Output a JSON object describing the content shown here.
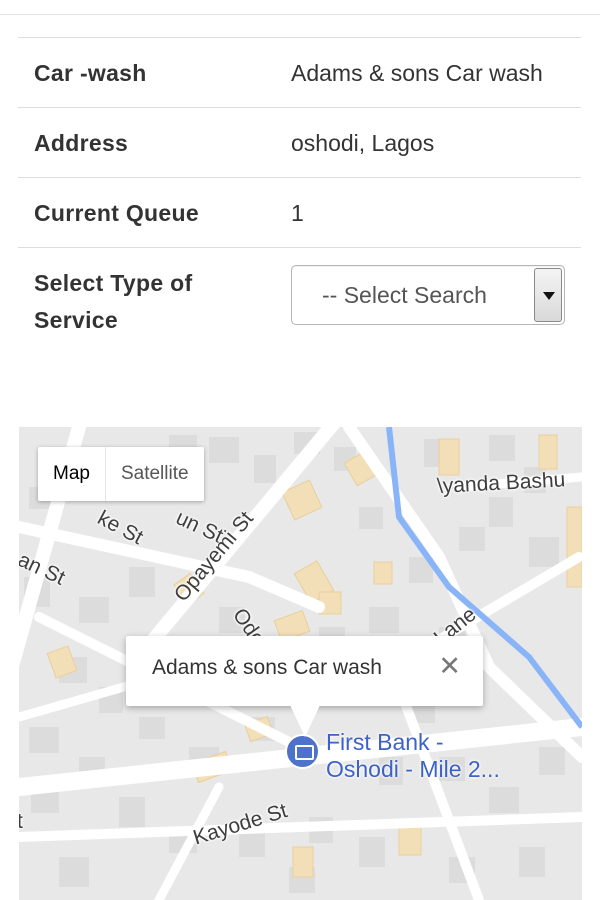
{
  "details": {
    "rows": [
      {
        "label": "Car -wash",
        "value": "Adams & sons Car wash"
      },
      {
        "label": "Address",
        "value": "oshodi, Lagos"
      },
      {
        "label": "Current Queue",
        "value": "1"
      }
    ],
    "service_label": "Select Type of Service",
    "service_select": {
      "selected": "-- Select Search"
    }
  },
  "map": {
    "type_controls": {
      "map": "Map",
      "satellite": "Satellite"
    },
    "infowindow": {
      "title": "Adams & sons Car wash",
      "close": "✕"
    },
    "poi": {
      "line1": "First Bank -",
      "line2": "Oshodi - Mile 2..."
    },
    "streets": {
      "opayemi": "Opayemi St",
      "kayode": "Kayode St",
      "ayanda": "\\yanda Bashu",
      "ke": "ke St",
      "un": "un St",
      "an": "an St",
      "ode": "Ode",
      "lane": "Lane",
      "t": "t"
    },
    "colors": {
      "water": "#8ab4f8",
      "building_highlight": "#f3dfb7",
      "poi": "#3c62c8"
    }
  }
}
